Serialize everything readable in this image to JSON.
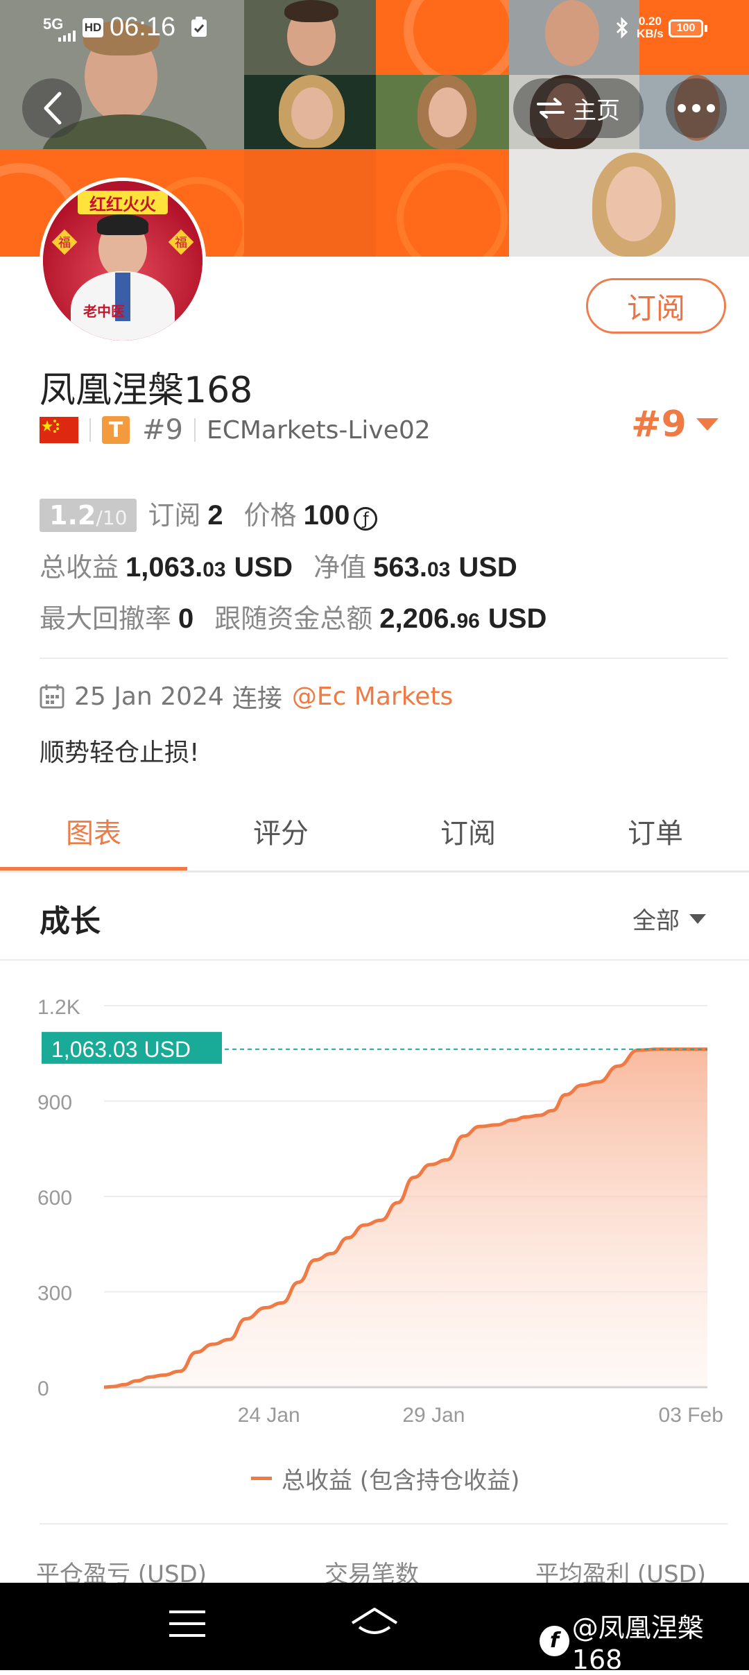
{
  "status_bar": {
    "network": "5G",
    "hd": "HD",
    "time": "06:16",
    "speed_value": "0.20",
    "speed_unit": "KB/s",
    "battery": "100"
  },
  "header": {
    "home_button_label": "主页"
  },
  "profile": {
    "avatar_banner": "红红火火",
    "avatar_fu": "福",
    "avatar_caption": "老中医",
    "name": "凤凰涅槃168",
    "t_badge": "T",
    "rank": "#9",
    "broker": "ECMarkets-Live02",
    "rank_right": "#9",
    "subscribe_button": "订阅"
  },
  "stats": {
    "rating_value": "1.2",
    "rating_max": "/10",
    "subscribers_label": "订阅",
    "subscribers_value": "2",
    "price_label": "价格",
    "price_value": "100",
    "coin_symbol": "ƒ",
    "total_profit_label": "总收益",
    "total_profit_int": "1,063.",
    "total_profit_dec": "03",
    "total_profit_unit": "USD",
    "equity_label": "净值",
    "equity_int": "563.",
    "equity_dec": "03",
    "equity_unit": "USD",
    "max_drawdown_label": "最大回撤率",
    "max_drawdown_value": "0",
    "follow_funds_label": "跟随资金总额",
    "follow_funds_int": "2,206.",
    "follow_funds_dec": "96",
    "follow_funds_unit": "USD"
  },
  "connection": {
    "date": "25 Jan 2024",
    "connect_label": "连接",
    "broker_link": "@Ec Markets"
  },
  "tagline": "顺势轻仓止损!",
  "tabs": [
    {
      "label": "图表",
      "active": true
    },
    {
      "label": "评分",
      "active": false
    },
    {
      "label": "订阅",
      "active": false
    },
    {
      "label": "订单",
      "active": false
    }
  ],
  "growth": {
    "title": "成长",
    "filter": "全部"
  },
  "chart_data": {
    "type": "area",
    "title": "",
    "xlabel": "",
    "ylabel": "",
    "ylim": [
      0,
      1200
    ],
    "y_ticks": [
      "0",
      "300",
      "600",
      "900",
      "1.2K"
    ],
    "x_tick_labels": [
      "24 Jan",
      "29 Jan",
      "03 Feb"
    ],
    "current_value_label": "1,063.03 USD",
    "current_value": 1063.03,
    "legend": [
      {
        "name": "总收益 (包含持仓收益)",
        "color": "#ef7a44"
      }
    ],
    "series": [
      {
        "name": "总收益 (包含持仓收益)",
        "x": [
          0,
          0.3,
          0.6,
          1.0,
          1.4,
          1.8,
          2.3,
          2.8,
          3.3,
          3.8,
          4.3,
          4.9,
          5.4,
          5.9,
          6.4,
          6.9,
          7.4,
          7.9,
          8.4,
          8.9,
          9.4,
          9.9,
          10.4,
          10.9,
          11.4,
          11.9,
          12.4,
          12.8,
          13.2,
          13.6,
          14.0,
          14.5,
          15.0,
          15.6,
          16.2,
          16.8,
          17.3,
          17.8,
          18.3
        ],
        "values": [
          0,
          2,
          8,
          20,
          32,
          38,
          50,
          110,
          135,
          150,
          215,
          250,
          265,
          330,
          400,
          420,
          470,
          510,
          525,
          580,
          660,
          700,
          715,
          790,
          820,
          825,
          840,
          850,
          855,
          870,
          920,
          950,
          960,
          1010,
          1060,
          1063.03,
          1063.03,
          1063.03,
          1063.03
        ]
      }
    ],
    "x_tick_positions": [
      5.0,
      10.0,
      17.8
    ],
    "grid": true,
    "line_color": "#ef7a44",
    "fill_color": "#fbc9b3",
    "reference_line_color": "#1aaa98"
  },
  "bottom_metrics": [
    "平仓盈亏 (USD)",
    "交易笔数",
    "平均盈利 (USD)"
  ],
  "watermark": "@凤凰涅槃168"
}
